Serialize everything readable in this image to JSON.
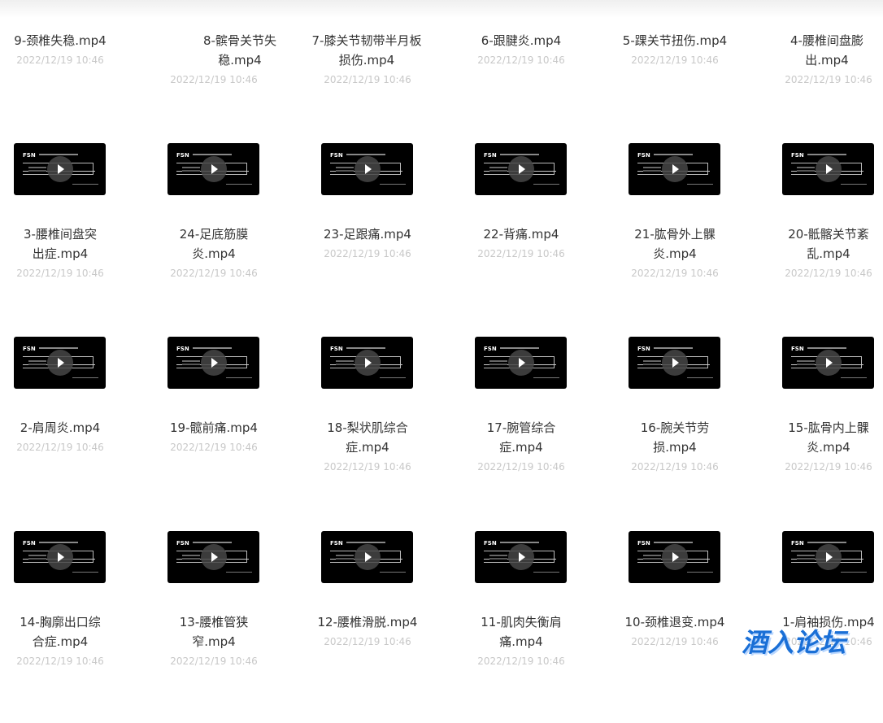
{
  "files": [
    {
      "name": "9-颈椎失稳.mp4",
      "date": "2022/12/19 10:46"
    },
    {
      "name": "8-髌骨关节失稳.mp4",
      "date": "2022/12/19 10:46"
    },
    {
      "name": "7-膝关节韧带半月板损伤.mp4",
      "date": "2022/12/19 10:46"
    },
    {
      "name": "6-跟腱炎.mp4",
      "date": "2022/12/19 10:46"
    },
    {
      "name": "5-踝关节扭伤.mp4",
      "date": "2022/12/19 10:46"
    },
    {
      "name": "4-腰椎间盘膨出.mp4",
      "date": "2022/12/19 10:46"
    },
    {
      "name": "3-腰椎间盘突出症.mp4",
      "date": "2022/12/19 10:46"
    },
    {
      "name": "24-足底筋膜炎.mp4",
      "date": "2022/12/19 10:46"
    },
    {
      "name": "23-足跟痛.mp4",
      "date": "2022/12/19 10:46"
    },
    {
      "name": "22-背痛.mp4",
      "date": "2022/12/19 10:46"
    },
    {
      "name": "21-肱骨外上髁炎.mp4",
      "date": "2022/12/19 10:46"
    },
    {
      "name": "20-骶髂关节紊乱.mp4",
      "date": "2022/12/19 10:46"
    },
    {
      "name": "2-肩周炎.mp4",
      "date": "2022/12/19 10:46"
    },
    {
      "name": "19-髋前痛.mp4",
      "date": "2022/12/19 10:46"
    },
    {
      "name": "18-梨状肌综合症.mp4",
      "date": "2022/12/19 10:46"
    },
    {
      "name": "17-腕管综合症.mp4",
      "date": "2022/12/19 10:46"
    },
    {
      "name": "16-腕关节劳损.mp4",
      "date": "2022/12/19 10:46"
    },
    {
      "name": "15-肱骨内上髁炎.mp4",
      "date": "2022/12/19 10:46"
    },
    {
      "name": "14-胸廓出口综合症.mp4",
      "date": "2022/12/19 10:46"
    },
    {
      "name": "13-腰椎管狭窄.mp4",
      "date": "2022/12/19 10:46"
    },
    {
      "name": "12-腰椎滑脱.mp4",
      "date": "2022/12/19 10:46"
    },
    {
      "name": "11-肌肉失衡肩痛.mp4",
      "date": "2022/12/19 10:46"
    },
    {
      "name": "10-颈椎退变.mp4",
      "date": "2022/12/19 10:46"
    },
    {
      "name": "1-肩袖损伤.mp4",
      "date": "2022/12/19 10:46"
    }
  ],
  "thumb_logo": "FSN",
  "watermark": "酒入论坛"
}
